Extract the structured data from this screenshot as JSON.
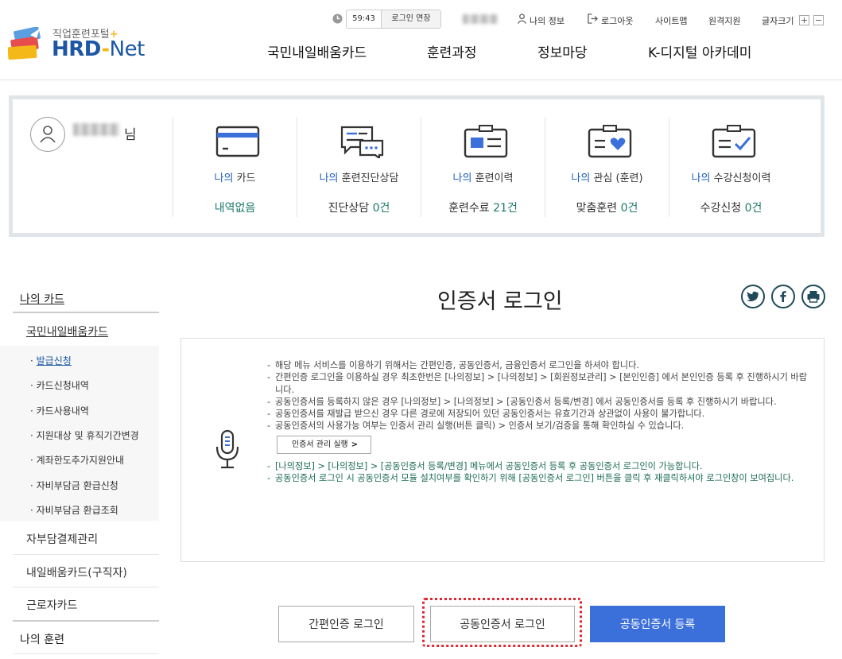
{
  "header": {
    "logo_sub": "직업훈련포털",
    "logo_main": "HRD",
    "logo_dash": "-",
    "logo_net": "Net",
    "timer": "59:43",
    "extend_label": "로그인 연장",
    "my_info": "나의 정보",
    "logout": "로그아웃",
    "sitemap": "사이트맵",
    "remote": "원격지원",
    "font_size": "글자크기",
    "font_plus": "+",
    "font_minus": "−",
    "gnb": [
      "국민내일배움카드",
      "훈련과정",
      "정보마당",
      "K-디지털 아카데미"
    ]
  },
  "user": {
    "suffix": "님",
    "cards": [
      {
        "my": "나의",
        "label": "카드",
        "value_pre": "내역없음",
        "num": ""
      },
      {
        "my": "나의",
        "label": "훈련진단상담",
        "value_pre": "진단상담",
        "num": "0건"
      },
      {
        "my": "나의",
        "label": "훈련이력",
        "value_pre": "훈련수료",
        "num": "21건"
      },
      {
        "my": "나의",
        "label": "관심 (훈련)",
        "value_pre": "맞춤훈련",
        "num": "0건"
      },
      {
        "my": "나의",
        "label": "수강신청이력",
        "value_pre": "수강신청",
        "num": "0건"
      }
    ]
  },
  "sidebar": {
    "top": "나의 카드",
    "sub": "국민내일배움카드",
    "items": [
      "발급신청",
      "카드신청내역",
      "카드사용내역",
      "지원대상 및 휴직기간변경",
      "계좌한도추가지원안내",
      "자비부담금 환급신청",
      "자비부담금 환급조회"
    ],
    "others": [
      "자부담결제관리",
      "내일배움카드(구직자)",
      "근로자카드"
    ],
    "bottom": "나의 훈련"
  },
  "main": {
    "title": "인증서 로그인",
    "info": [
      "해당 메뉴 서비스를 이용하기 위해서는 간편인증, 공동인증서, 금융인증서 로그인을 하셔야 합니다.",
      "간편인증 로그인을 이용하실 경우 최초한번은 [나의정보] > [나의정보] > [회원정보관리] > [본인인증] 에서 본인인증 등록 후 진행하시기 바랍니다.",
      "공동인증서를 등록하지 않은 경우 [나의정보] > [나의정보] > [공동인증서 등록/변경] 에서 공동인증서를 등록 후 진행하시기 바랍니다.",
      "공동인증서를 재발급 받으신 경우 다른 경로에 저장되어 있던 공동인증서는 유효기간과 상관없이 사용이 불가합니다.",
      "공동인증서의 사용가능 여부는 인증서 관리 실행(버튼 클릭) > 인증서 보기/검증을 통해 확인하실 수 있습니다."
    ],
    "manage_btn": "인증서 관리 실행",
    "info_green": [
      "[나의정보] > [나의정보] > [공동인증서 등록/변경] 메뉴에서 공동인증서 등록 후 공동인증서 로그인이 가능합니다.",
      "공동인증서 로그인 시 공동인증서 모듈 설치여부를 확인하기 위해 [공동인증서 로그인] 버튼을 클릭 후 재클릭하셔야 로그인창이 보여집니다."
    ],
    "btn_simple": "간편인증 로그인",
    "btn_cert": "공동인증서 로그인",
    "btn_register": "공동인증서 등록"
  },
  "colors": {
    "brand_blue": "#1c57a5",
    "primary_btn": "#3b6fd9",
    "highlight": "#e0262f",
    "accent_green": "#1d7a6a"
  }
}
